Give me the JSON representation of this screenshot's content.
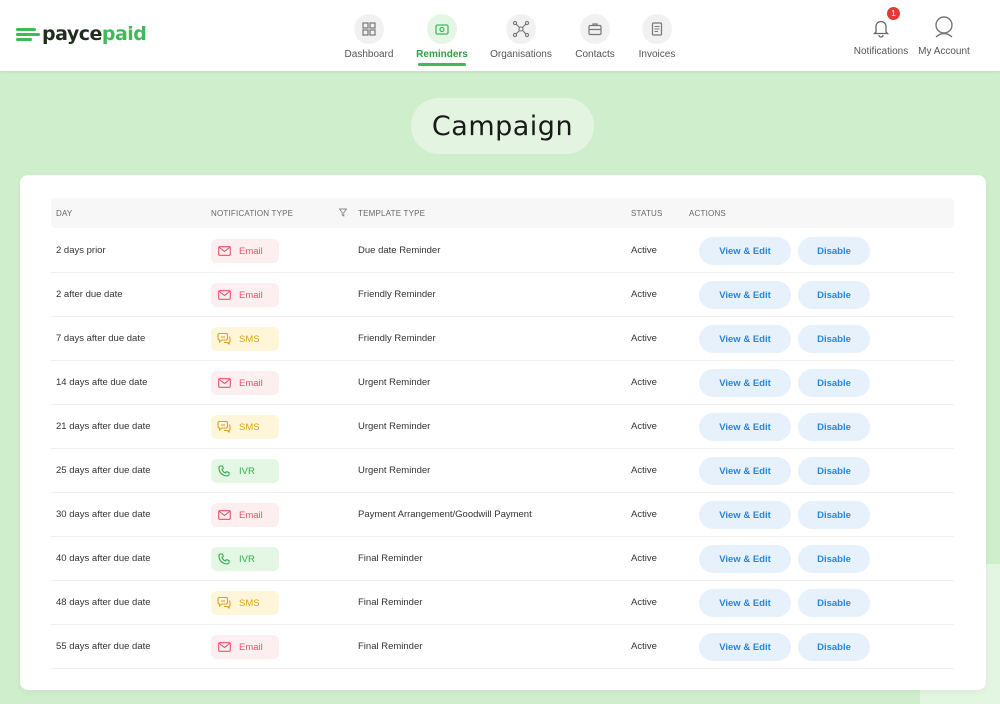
{
  "brand": {
    "part1": "payce",
    "part2": "paid"
  },
  "nav": [
    {
      "label": "Dashboard",
      "icon": "dashboard-icon"
    },
    {
      "label": "Reminders",
      "icon": "reminders-icon",
      "active": true
    },
    {
      "label": "Organisations",
      "icon": "organisations-icon"
    },
    {
      "label": "Contacts",
      "icon": "contacts-icon"
    },
    {
      "label": "Invoices",
      "icon": "invoices-icon"
    }
  ],
  "header_right": {
    "notifications_label": "Notifications",
    "notifications_count": "1",
    "account_label": "My Account"
  },
  "page_title": "Campaign",
  "table": {
    "columns": [
      "DAY",
      "NOTIFICATION TYPE",
      "TEMPLATE TYPE",
      "STATUS",
      "ACTIONS"
    ],
    "rows": [
      {
        "day": "2 days prior",
        "type": "Email",
        "template": "Due date Reminder",
        "status": "Active",
        "edit": "View & Edit",
        "disable": "Disable"
      },
      {
        "day": "2 after due date",
        "type": "Email",
        "template": "Friendly Reminder",
        "status": "Active",
        "edit": "View & Edit",
        "disable": "Disable"
      },
      {
        "day": "7 days after due date",
        "type": "SMS",
        "template": "Friendly Reminder",
        "status": "Active",
        "edit": "View & Edit",
        "disable": "Disable"
      },
      {
        "day": "14 days afte due date",
        "type": "Email",
        "template": "Urgent Reminder",
        "status": "Active",
        "edit": "View & Edit",
        "disable": "Disable"
      },
      {
        "day": "21 days after due date",
        "type": "SMS",
        "template": "Urgent Reminder",
        "status": "Active",
        "edit": "View & Edit",
        "disable": "Disable"
      },
      {
        "day": "25 days after due date",
        "type": "IVR",
        "template": "Urgent Reminder",
        "status": "Active",
        "edit": "View & Edit",
        "disable": "Disable"
      },
      {
        "day": "30 days after due date",
        "type": "Email",
        "template": "Payment Arrangement/Goodwill Payment",
        "status": "Active",
        "edit": "View & Edit",
        "disable": "Disable"
      },
      {
        "day": "40 days after due date",
        "type": "IVR",
        "template": "Final Reminder",
        "status": "Active",
        "edit": "View & Edit",
        "disable": "Disable"
      },
      {
        "day": "48 days after due date",
        "type": "SMS",
        "template": "Final Reminder",
        "status": "Active",
        "edit": "View & Edit",
        "disable": "Disable"
      },
      {
        "day": "55 days after due date",
        "type": "Email",
        "template": "Final Reminder",
        "status": "Active",
        "edit": "View & Edit",
        "disable": "Disable"
      }
    ]
  },
  "colors": {
    "brand_green": "#3dbb58",
    "background": "#cfeecc",
    "email": "#e5546c",
    "sms": "#d6a420",
    "ivr": "#3aa94c",
    "action_blue": "#2a85d6"
  }
}
